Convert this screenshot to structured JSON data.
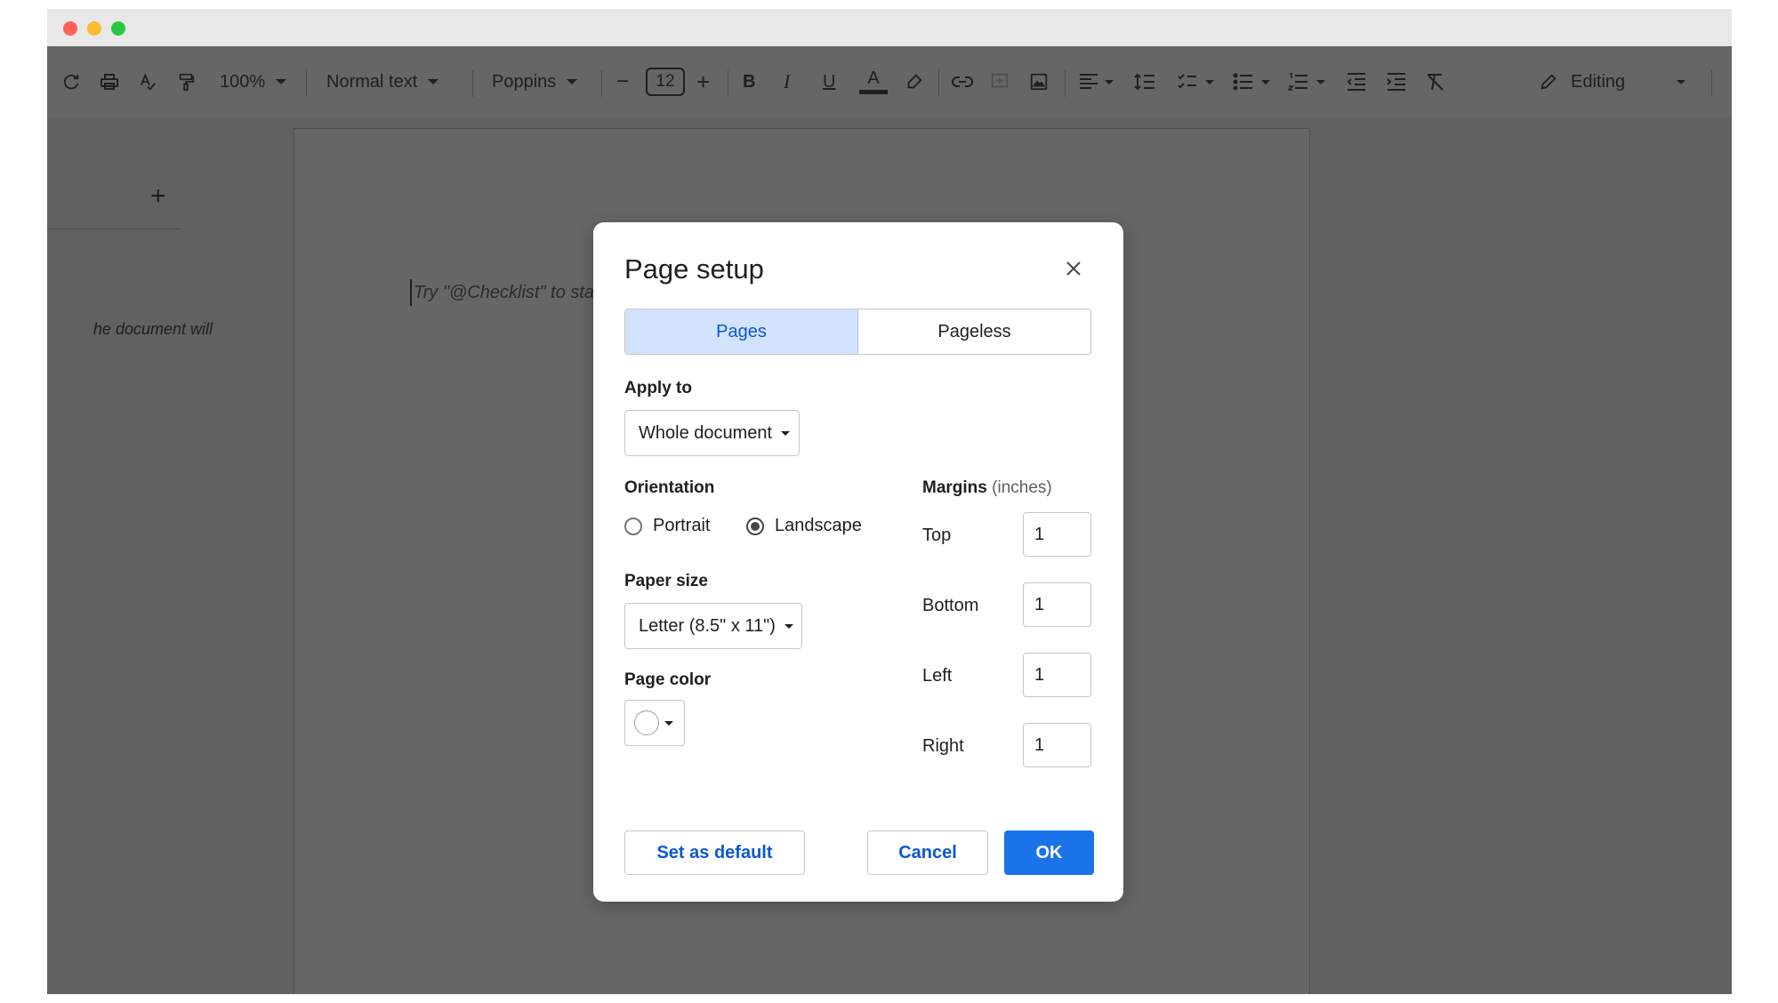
{
  "toolbar": {
    "zoom": "100%",
    "style": "Normal text",
    "font": "Poppins",
    "font_size": "12",
    "mode": "Editing",
    "icons": [
      "redo-icon",
      "print-icon",
      "spellcheck-icon",
      "paint-format-icon",
      "bold-icon",
      "italic-icon",
      "underline-icon",
      "text-color-icon",
      "highlight-icon",
      "link-icon",
      "comment-icon",
      "image-icon",
      "align-icon",
      "line-spacing-icon",
      "checklist-icon",
      "bullet-list-icon",
      "numbered-list-icon",
      "decrease-indent-icon",
      "increase-indent-icon",
      "clear-formatting-icon",
      "pencil-icon"
    ]
  },
  "toolbar_labels": {
    "bold": "B",
    "italic": "I",
    "underline": "U",
    "text_color": "A",
    "minus": "−",
    "plus": "+"
  },
  "sidepanel": {
    "add": "+",
    "text": "he document will"
  },
  "document": {
    "placeholder": "Try \"@Checklist\" to sta"
  },
  "dialog": {
    "title": "Page setup",
    "tabs": [
      {
        "label": "Pages",
        "active": true
      },
      {
        "label": "Pageless",
        "active": false
      }
    ],
    "apply_to": {
      "label": "Apply to",
      "value": "Whole document"
    },
    "orientation": {
      "label": "Orientation",
      "options": [
        "Portrait",
        "Landscape"
      ],
      "selected": "Landscape"
    },
    "paper_size": {
      "label": "Paper size",
      "value": "Letter (8.5\" x 11\")"
    },
    "page_color": {
      "label": "Page color",
      "value": "#ffffff"
    },
    "margins": {
      "label": "Margins",
      "unit": "(inches)",
      "top_label": "Top",
      "top": "1",
      "bottom_label": "Bottom",
      "bottom": "1",
      "left_label": "Left",
      "left": "1",
      "right_label": "Right",
      "right": "1"
    },
    "buttons": {
      "set_default": "Set as default",
      "cancel": "Cancel",
      "ok": "OK"
    }
  },
  "colors": {
    "accent": "#1a73e8",
    "tab_active_bg": "#d3e3fd",
    "tab_active_text": "#0b57d0",
    "overlay": "#616161"
  }
}
